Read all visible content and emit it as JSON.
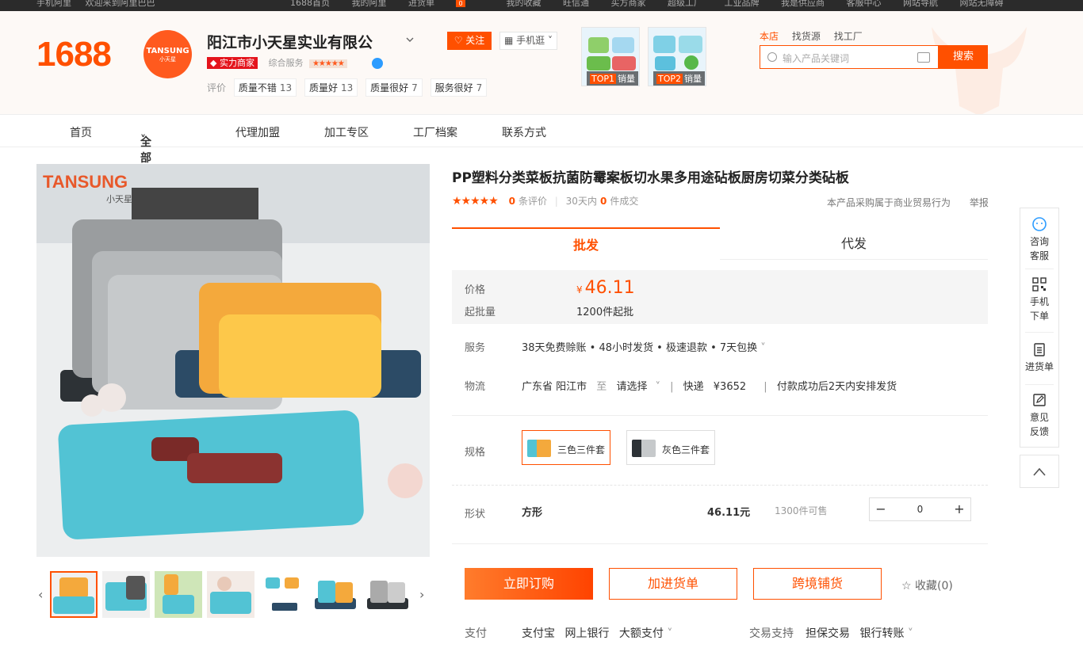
{
  "topbar": {
    "left": [
      "手机阿里",
      "欢迎来到阿里巴巴"
    ],
    "nav": [
      "1688首页",
      "我的阿里",
      "进货单",
      "我的收藏",
      "旺信通",
      "买方商家",
      "超级工厂",
      "工业品牌",
      "我是供应商",
      "客服中心",
      "网站导航",
      "网站无障碍"
    ],
    "cart_count": "0"
  },
  "header": {
    "logo": "1688",
    "avatar_brand": "TANSUNG",
    "avatar_sub": "小天星",
    "company": "阳江市小天星实业有限公",
    "tag": "实力商家",
    "service_label": "综合服务",
    "service_stars": "★★★★★",
    "ratings_label": "评价",
    "ratings": [
      {
        "label": "质量不错",
        "count": "13"
      },
      {
        "label": "质量好",
        "count": "13"
      },
      {
        "label": "质量很好",
        "count": "7"
      },
      {
        "label": "服务很好",
        "count": "7"
      }
    ],
    "follow_label": "关注",
    "mobile_label": "手机逛",
    "top_products": [
      {
        "rank": "TOP1",
        "text": "销量"
      },
      {
        "rank": "TOP2",
        "text": "销量"
      }
    ],
    "search_tabs": [
      "本店",
      "找货源",
      "找工厂"
    ],
    "search_placeholder": "输入产品关键词",
    "search_button": "搜索"
  },
  "mainnav": [
    "首页",
    "全部商品",
    "代理加盟",
    "加工专区",
    "工厂档案",
    "联系方式"
  ],
  "gallery": {
    "brand": "TANSUNG",
    "brand_sub": "小天星"
  },
  "product": {
    "title": "PP塑料分类菜板抗菌防霉案板切水果多用途砧板厨房切菜分类砧板",
    "stars": "★★★★★",
    "review_count": "0",
    "review_label": "条评价",
    "deal_prefix": "30天内",
    "deal_count": "0",
    "deal_label": "件成交",
    "note": "本产品采购属于商业贸易行为",
    "report": "举报",
    "tabs": [
      "批发",
      "代发"
    ],
    "price_label": "价格",
    "currency": "¥",
    "price": "46.11",
    "moq_label": "起批量",
    "moq": "1200件起批",
    "service_label": "服务",
    "service": "38天免费赊账 • 48小时发货 • 极速退款 • 7天包换",
    "logistics_label": "物流",
    "origin": "广东省 阳江市",
    "to": "至",
    "destination": "请选择",
    "express": "快递",
    "express_price": "¥3652",
    "ship_note": "付款成功后2天内安排发货",
    "spec_label": "规格",
    "specs": [
      "三色三件套",
      "灰色三件套"
    ],
    "shape_label": "形状",
    "shape_name": "方形",
    "shape_price": "46.11元",
    "shape_stock": "1300件可售",
    "quantity": "0",
    "buy_now": "立即订购",
    "add_cart": "加进货单",
    "cross_border": "跨境铺货",
    "favorite": "收藏(0)",
    "pay_label": "支付",
    "pay_methods": [
      "支付宝",
      "网上银行",
      "大额支付"
    ],
    "trade_label": "交易支持",
    "trade_methods": [
      "担保交易",
      "银行转账"
    ]
  },
  "sidebar": [
    {
      "line1": "咨询",
      "line2": "客服"
    },
    {
      "line1": "手机",
      "line2": "下单"
    },
    {
      "line1": "进货单",
      "line2": ""
    },
    {
      "line1": "意见",
      "line2": "反馈"
    }
  ],
  "colors": {
    "accent": "#ff5000",
    "tag_red": "#e4141c"
  }
}
